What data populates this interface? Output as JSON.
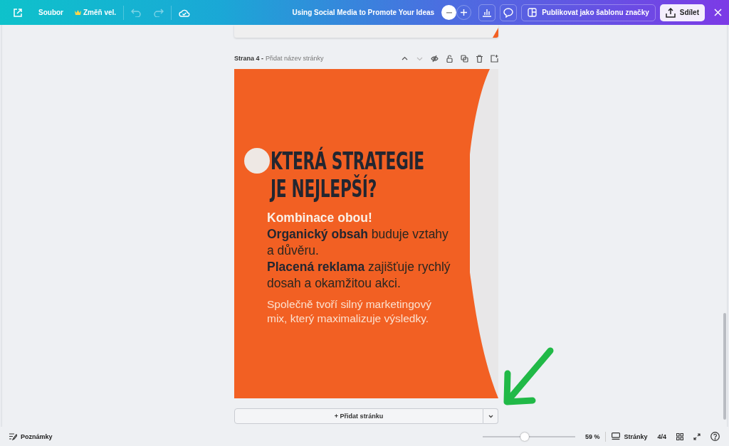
{
  "topbar": {
    "file_menu": "Soubor",
    "resize_button": "Změň vel.",
    "document_title": "Using Social Media to Promote Your Ideas",
    "publish_button": "Publikovat jako šablonu značky",
    "share_button": "Sdílet"
  },
  "page": {
    "label": "Strana 4 -",
    "title_placeholder": "Přidat název stránky",
    "move_down_disabled": true,
    "slide": {
      "heading_lines": [
        "KTERÁ STRATEGIE",
        "JE NEJLEPŠÍ?"
      ],
      "paragraphs": [
        {
          "kind": "highlight",
          "text": "Kombinace obou!"
        },
        {
          "kind": "body",
          "text": "**Organický obsah** buduje vztahy a důvěru."
        },
        {
          "kind": "body",
          "text": "**Placená reklama** zajišťuje rychlý dosah a okamžitou akci."
        },
        {
          "kind": "note",
          "text": "Společně tvoří silný marketingový mix, který maximalizuje výsledky."
        }
      ]
    }
  },
  "add_page_button": "+ Přidat stránku",
  "footer": {
    "notes_button": "Poznámky",
    "zoom": {
      "level": 0.45
    },
    "zoom_reading": "59 %",
    "pages_button": "Stránky",
    "page_count": "4/4"
  }
}
